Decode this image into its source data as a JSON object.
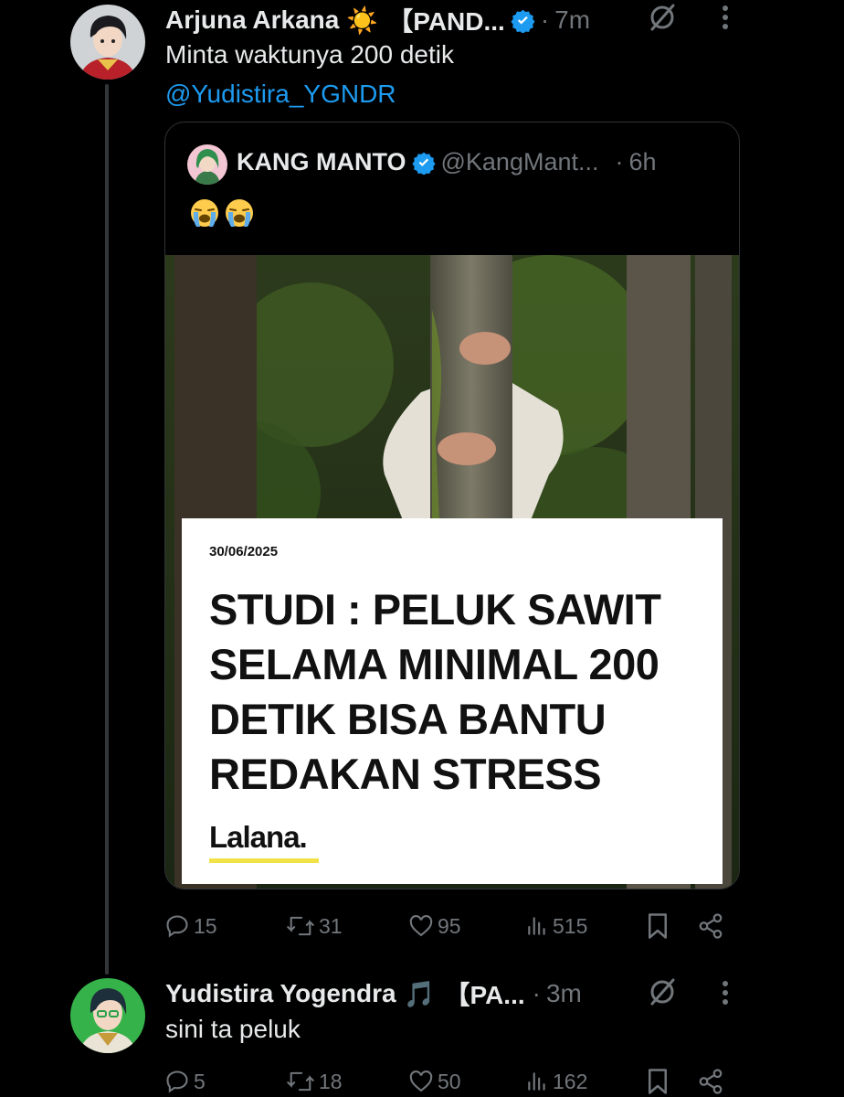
{
  "reply1": {
    "name": "Arjuna Arkana",
    "name_suffix": "☀️",
    "tag": "【PAND...",
    "dot": "·",
    "time": "7m",
    "text": "Minta waktunya 200 detik",
    "mention": "@Yudistira_YGNDR",
    "quote": {
      "name": "KANG MANTO",
      "handle": "@KangMant...",
      "dot": "·",
      "time": "6h",
      "emoji_name": "loudly-crying-face",
      "media": {
        "date": "30/06/2025",
        "headline_lines": [
          "STUDI : PELUK SAWIT",
          "SELAMA MINIMAL 200",
          "DETIK BISA BANTU",
          "REDAKAN STRESS"
        ],
        "brand": "Lalana."
      }
    },
    "actions": {
      "replies": "15",
      "reposts": "31",
      "likes": "95",
      "views": "515"
    }
  },
  "reply2": {
    "name": "Yudistira Yogendra",
    "name_suffix": "🎵",
    "tag": "【PA...",
    "dot": "·",
    "time": "3m",
    "text": "sini ta peluk",
    "actions": {
      "replies": "5",
      "reposts": "18",
      "likes": "50",
      "views": "162"
    }
  },
  "colors": {
    "background": "#000000",
    "text_primary": "#e7e9ea",
    "text_muted": "#71767b",
    "accent_blue": "#1d9bf0",
    "border": "#2f3336"
  }
}
